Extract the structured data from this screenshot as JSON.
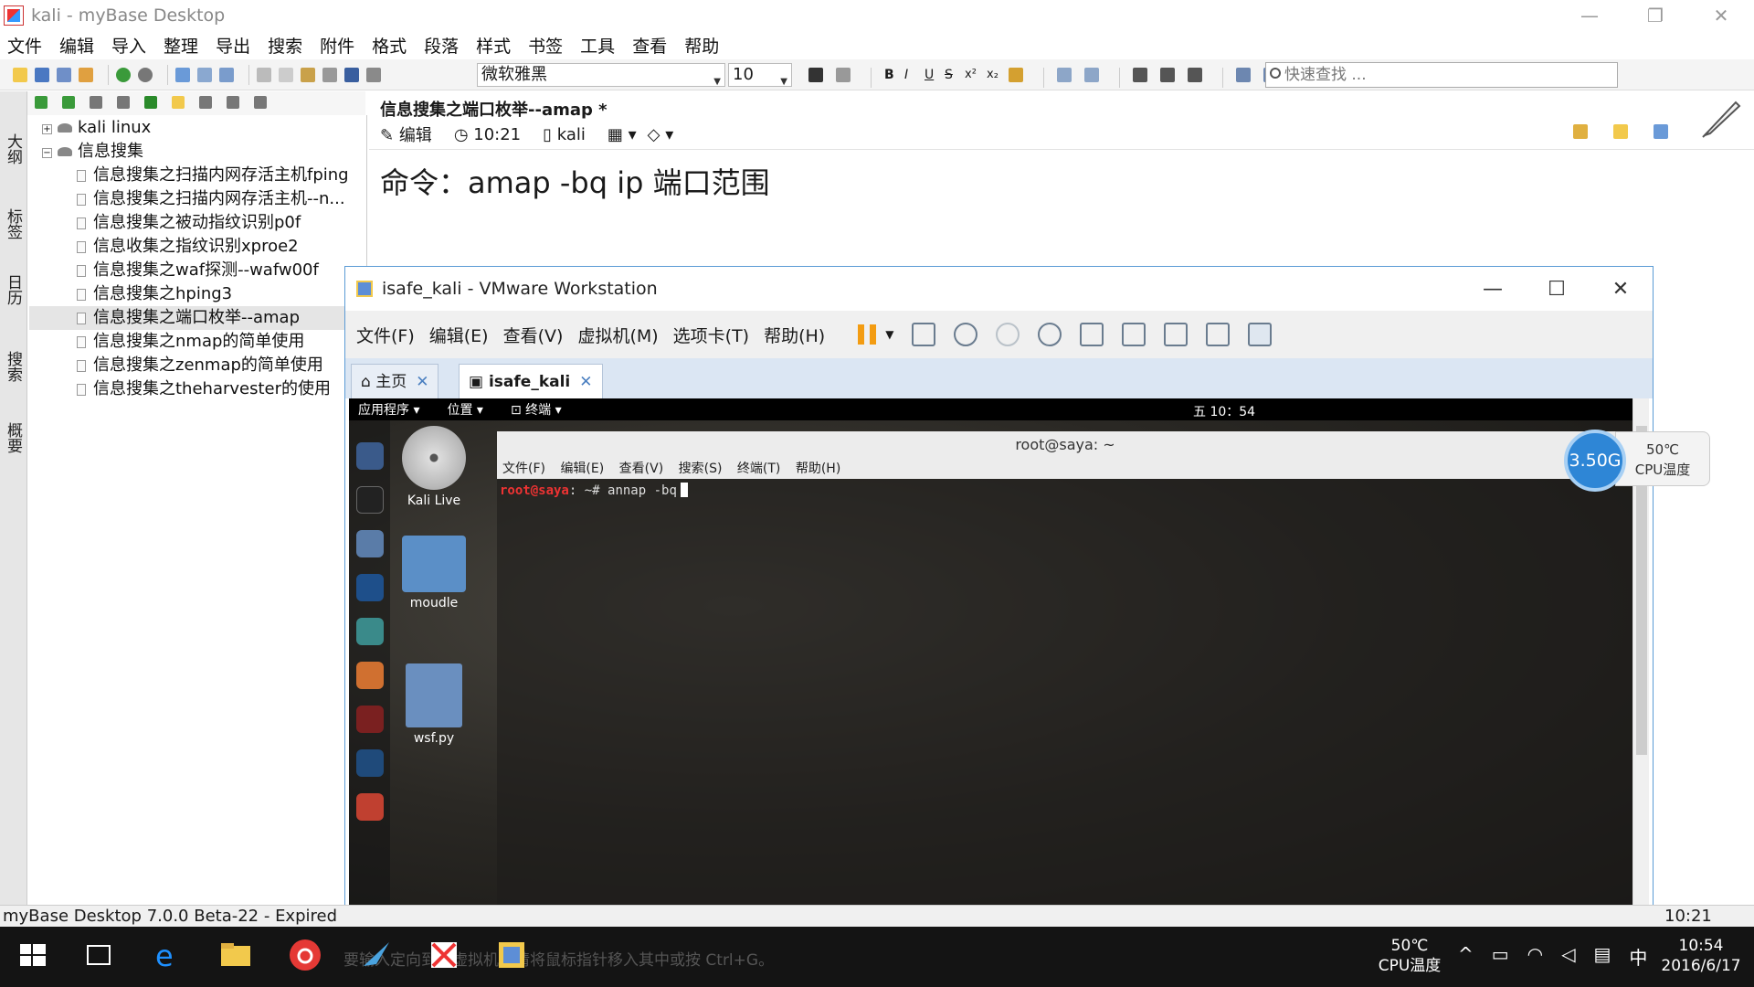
{
  "window": {
    "title": "kali - myBase Desktop",
    "controls": [
      "—",
      "❐",
      "✕"
    ]
  },
  "menubar": [
    "文件",
    "编辑",
    "导入",
    "整理",
    "导出",
    "搜索",
    "附件",
    "格式",
    "段落",
    "样式",
    "书签",
    "工具",
    "查看",
    "帮助"
  ],
  "toolbar": {
    "font": "微软雅黑",
    "size": "10",
    "search_placeholder": "快速查找 ..."
  },
  "vtabs": [
    "大纲",
    "标签",
    "日历",
    "搜索",
    "概要"
  ],
  "tree": {
    "root": "kali linux",
    "folder": "信息搜集",
    "items": [
      "信息搜集之扫描内网存活主机fping",
      "信息搜集之扫描内网存活主机--n...",
      "信息搜集之被动指纹识别p0f",
      "信息收集之指纹识别xproe2",
      "信息搜集之waf探测--wafw00f",
      "信息搜集之hping3",
      "信息搜集之端口枚举--amap",
      "信息搜集之nmap的简单使用",
      "信息搜集之zenmap的简单使用",
      "信息搜集之theharvester的使用"
    ],
    "selected_index": 6
  },
  "doc": {
    "title": "信息搜集之端口枚举--amap *",
    "mode": "编辑",
    "time": "10:21",
    "owner": "kali",
    "content": "命令：amap -bq ip 端口范围"
  },
  "vmware": {
    "title": "isafe_kali - VMware Workstation",
    "menu": [
      "文件(F)",
      "编辑(E)",
      "查看(V)",
      "虚拟机(M)",
      "选项卡(T)",
      "帮助(H)"
    ],
    "tabs": [
      {
        "label": "主页"
      },
      {
        "label": "isafe_kali"
      }
    ],
    "guest": {
      "topbar": [
        "应用程序 ▾",
        "位置 ▾",
        "⊡ 终端 ▾"
      ],
      "clock": "五 10：54",
      "desktop_icons": [
        "Kali Live",
        "moudle",
        "wsf.py"
      ],
      "terminal": {
        "title": "root@saya: ~",
        "menu": [
          "文件(F)",
          "编辑(E)",
          "查看(V)",
          "搜索(S)",
          "终端(T)",
          "帮助(H)"
        ],
        "user": "root@saya",
        "prompt": ": ~# ",
        "command": "annap -bq"
      }
    }
  },
  "cpu_widget": {
    "usage": "3.50G",
    "temp": "50℃",
    "label": "CPU温度"
  },
  "status": {
    "left": "myBase Desktop 7.0.0 Beta-22 - Expired",
    "right": "10:21"
  },
  "taskbar": {
    "tip": "要输入定向到该虚拟机，请将鼠标指针移入其中或按 Ctrl+G。",
    "temp": "50℃",
    "temp_label": "CPU温度",
    "lang": "中",
    "time": "10:54",
    "date": "2016/6/17"
  },
  "colors": {
    "accent": "#2e86d6",
    "vm_border": "#5b9bd5",
    "pause": "#f39c12",
    "terminal_user": "#ee3333"
  }
}
